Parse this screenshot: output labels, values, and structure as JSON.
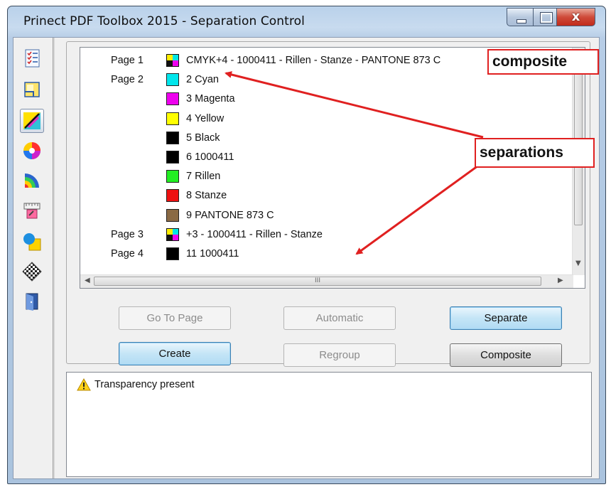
{
  "window": {
    "title": "Prinect PDF Toolbox 2015 - Separation Control",
    "close_glyph": "x"
  },
  "toolbar": {
    "tools": [
      {
        "name": "checklist-icon"
      },
      {
        "name": "page-layout-icon"
      },
      {
        "name": "separation-control-icon",
        "active": true
      },
      {
        "name": "color-wheel-icon"
      },
      {
        "name": "color-fan-icon"
      },
      {
        "name": "ruler-edit-icon"
      },
      {
        "name": "shapes-overlay-icon"
      },
      {
        "name": "checkerboard-icon"
      },
      {
        "name": "exit-door-icon"
      }
    ]
  },
  "separations": {
    "rows": [
      {
        "page": "Page 1",
        "swatch": "cmyk",
        "label": "CMYK+4 - 1000411 - Rillen - Stanze - PANTONE 873 C"
      },
      {
        "page": "Page 2",
        "swatch": "#00e6ec",
        "label": "2 Cyan"
      },
      {
        "page": "",
        "swatch": "#ee00ee",
        "label": "3 Magenta"
      },
      {
        "page": "",
        "swatch": "#ffff00",
        "label": "4 Yellow"
      },
      {
        "page": "",
        "swatch": "#000000",
        "label": "5 Black"
      },
      {
        "page": "",
        "swatch": "#000000",
        "label": "6 1000411"
      },
      {
        "page": "",
        "swatch": "#22ee22",
        "label": "7 Rillen"
      },
      {
        "page": "",
        "swatch": "#ee1111",
        "label": "8 Stanze"
      },
      {
        "page": "",
        "swatch": "#8a6a44",
        "label": "9 PANTONE 873 C"
      },
      {
        "page": "Page 3",
        "swatch": "cmyk",
        "label": "+3 - 1000411 - Rillen - Stanze"
      },
      {
        "page": "Page 4",
        "swatch": "#000000",
        "label": "11 1000411"
      }
    ],
    "hscroll_grip": "III"
  },
  "buttons": {
    "go_to_page": "Go To Page",
    "automatic": "Automatic",
    "separate": "Separate",
    "create": "Create",
    "regroup": "Regroup",
    "composite": "Composite"
  },
  "messages": {
    "transparency": "Transparency present"
  },
  "annotations": {
    "composite": "composite",
    "separations": "separations",
    "color": "#e02020"
  }
}
